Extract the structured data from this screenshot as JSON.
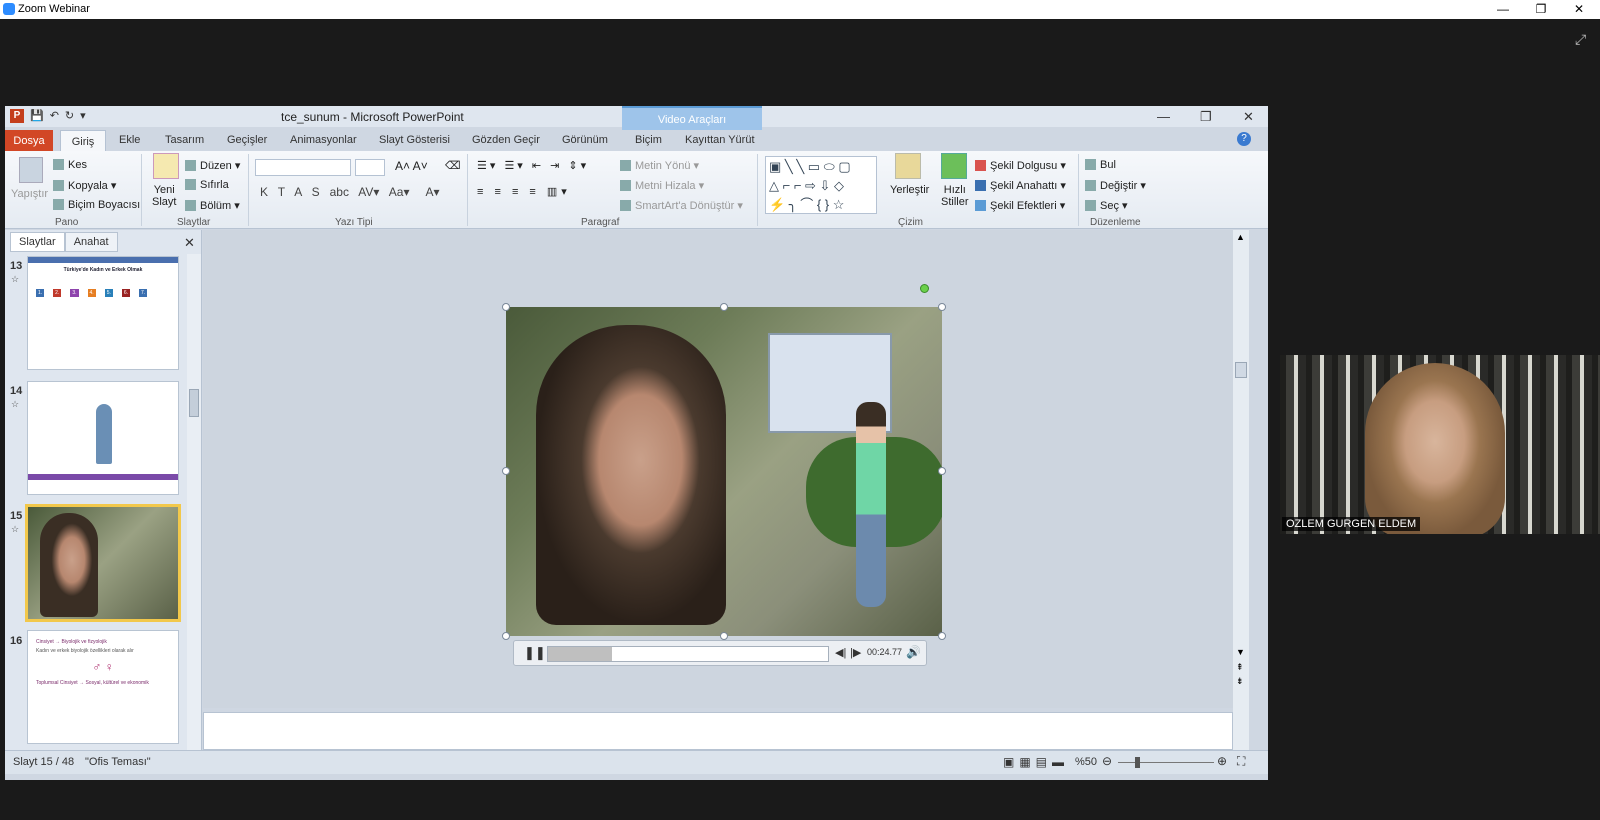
{
  "zoom": {
    "title": "Zoom Webinar",
    "participant": "OZLEM GURGEN ELDEM"
  },
  "ppt": {
    "title": "tce_sunum  -  Microsoft PowerPoint",
    "context_tab": "Video Araçları",
    "tabs": [
      "Dosya",
      "Giriş",
      "Ekle",
      "Tasarım",
      "Geçişler",
      "Animasyonlar",
      "Slayt Gösterisi",
      "Gözden Geçir",
      "Görünüm",
      "Biçim",
      "Kayıttan Yürüt"
    ],
    "groups": {
      "pano": "Pano",
      "slaytlar": "Slaytlar",
      "yazi": "Yazı Tipi",
      "paragraf": "Paragraf",
      "cizim": "Çizim",
      "duzenleme": "Düzenleme"
    },
    "buttons": {
      "yapistir": "Yapıştır",
      "kes": "Kes",
      "kopyala": "Kopyala",
      "bicim_boyacisi": "Biçim Boyacısı",
      "yeni_slayt": "Yeni\nSlayt",
      "duzen": "Düzen",
      "sifirla": "Sıfırla",
      "bolum": "Bölüm",
      "metin_yonu": "Metin Yönü",
      "metni_hizala": "Metni Hizala",
      "smartart": "SmartArt'a Dönüştür",
      "yerlestir": "Yerleştir",
      "hizli_stiller": "Hızlı\nStiller",
      "sekil_dolgusu": "Şekil Dolgusu",
      "sekil_anahatti": "Şekil Anahattı",
      "sekil_efektleri": "Şekil Efektleri",
      "bul": "Bul",
      "degistir": "Değiştir",
      "sec": "Seç"
    },
    "panel_tabs": [
      "Slaytlar",
      "Anahat"
    ],
    "slides": [
      {
        "num": "13",
        "title": "Türkiye'de Kadın ve Erkek Olmak",
        "boxes": [
          "1.",
          "2.",
          "3.",
          "4.",
          "5.",
          "6.",
          "7."
        ]
      },
      {
        "num": "14"
      },
      {
        "num": "15"
      },
      {
        "num": "16",
        "lines": [
          "Cinsiyet  →  Biyolojik ve fizyolojik",
          "Kadın ve erkek biyolojik özellikleri olarak alır",
          "Toplumsal Cinsiyet → Sosyal, kültürel ve ekonomik"
        ]
      }
    ],
    "video_time": "00:24.77",
    "video_progress": 0.23,
    "status": {
      "slide": "Slayt 15 / 48",
      "theme": "\"Ofis Teması\"",
      "zoom": "%50"
    }
  },
  "colors": {
    "dosya": "#d24726",
    "accent": "#2b579a",
    "selected": "#f2c84b"
  }
}
